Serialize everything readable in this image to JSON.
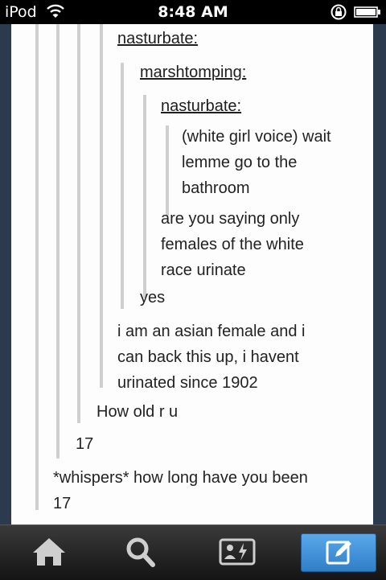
{
  "status_bar": {
    "carrier": "iPod",
    "time": "8:48 AM"
  },
  "thread": [
    {
      "kind": "username",
      "text": "nasturbate:"
    },
    {
      "kind": "username",
      "text": "marshtomping:"
    },
    {
      "kind": "username",
      "text": "nasturbate:"
    },
    {
      "kind": "text",
      "lines": [
        "(white girl voice) wait",
        "lemme go to the",
        "bathroom"
      ]
    },
    {
      "kind": "text",
      "lines": [
        "are you saying only",
        "females of the white",
        "race urinate"
      ]
    },
    {
      "kind": "text",
      "lines": [
        "yes"
      ]
    },
    {
      "kind": "text",
      "lines": [
        "i am an asian female and i",
        "can back this up, i havent",
        "urinated since 1902"
      ]
    },
    {
      "kind": "text",
      "lines": [
        "How old r u"
      ]
    },
    {
      "kind": "text",
      "lines": [
        "17"
      ]
    },
    {
      "kind": "text",
      "lines": [
        "*whispers* how long have you been",
        "17"
      ]
    }
  ],
  "tab_bar": {
    "items": [
      {
        "icon": "home-icon"
      },
      {
        "icon": "search-icon"
      },
      {
        "icon": "activity-icon"
      },
      {
        "icon": "compose-icon"
      }
    ]
  },
  "colors": {
    "accent": "#2f7fc8",
    "background": "#2c3a4e"
  }
}
